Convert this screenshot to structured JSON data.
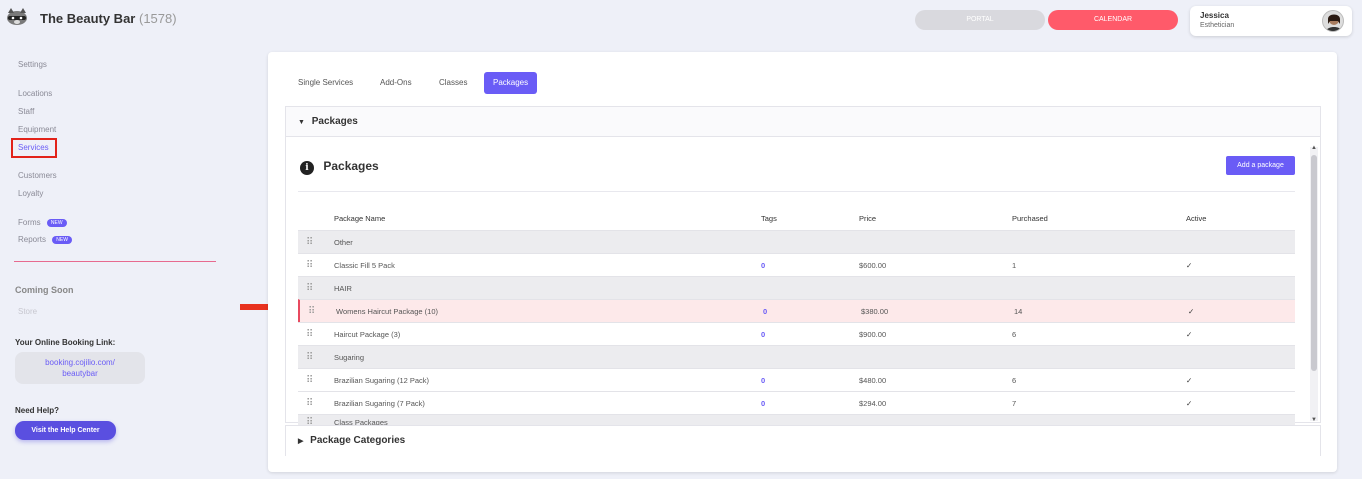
{
  "header": {
    "brand": "The Beauty Bar",
    "brand_count": "(1578)",
    "portal_label": "PORTAL",
    "calendar_label": "CALENDAR",
    "user_name": "Jessica",
    "user_role": "Esthetician"
  },
  "sidebar": {
    "settings": "Settings",
    "locations": "Locations",
    "staff": "Staff",
    "equipment": "Equipment",
    "services": "Services",
    "customers": "Customers",
    "loyalty": "Loyalty",
    "forms": "Forms",
    "reports": "Reports",
    "new_badge": "NEW",
    "coming_soon": "Coming Soon",
    "store": "Store",
    "booking_title": "Your Online Booking Link:",
    "booking_line1": "booking.cojilio.com/",
    "booking_line2": "beautybar",
    "help_title": "Need Help?",
    "help_button": "Visit the Help Center"
  },
  "tabs": [
    "Single Services",
    "Add-Ons",
    "Classes",
    "Packages"
  ],
  "packages_section": {
    "header": "Packages",
    "title": "Packages",
    "add_button": "Add a package",
    "columns": [
      "Package Name",
      "Tags",
      "Price",
      "Purchased",
      "Active"
    ],
    "rows": [
      {
        "type": "group",
        "name": "Other"
      },
      {
        "type": "item",
        "name": "Classic Fill 5 Pack",
        "tags": "0",
        "price": "$600.00",
        "purchased": "1",
        "active": "✓"
      },
      {
        "type": "group",
        "name": "HAIR"
      },
      {
        "type": "item",
        "name": "Womens Haircut Package (10)",
        "tags": "0",
        "price": "$380.00",
        "purchased": "14",
        "active": "✓",
        "highlighted": true
      },
      {
        "type": "item",
        "name": "Haircut Package (3)",
        "tags": "0",
        "price": "$900.00",
        "purchased": "6",
        "active": "✓"
      },
      {
        "type": "group",
        "name": "Sugaring"
      },
      {
        "type": "item",
        "name": "Brazilian Sugaring (12 Pack)",
        "tags": "0",
        "price": "$480.00",
        "purchased": "6",
        "active": "✓"
      },
      {
        "type": "item",
        "name": "Brazilian Sugaring (7 Pack)",
        "tags": "0",
        "price": "$294.00",
        "purchased": "7",
        "active": "✓"
      },
      {
        "type": "group",
        "name": "Class Packages"
      }
    ]
  },
  "categories_section": {
    "header": "Package Categories"
  },
  "colors": {
    "accent": "#6a5cf6",
    "calendar": "#ff5a6a",
    "annotation": "#e2231a"
  },
  "icons": {
    "drag": "drag-handle-icon",
    "info": "info-icon",
    "annotation": "arrow-right-icon"
  }
}
